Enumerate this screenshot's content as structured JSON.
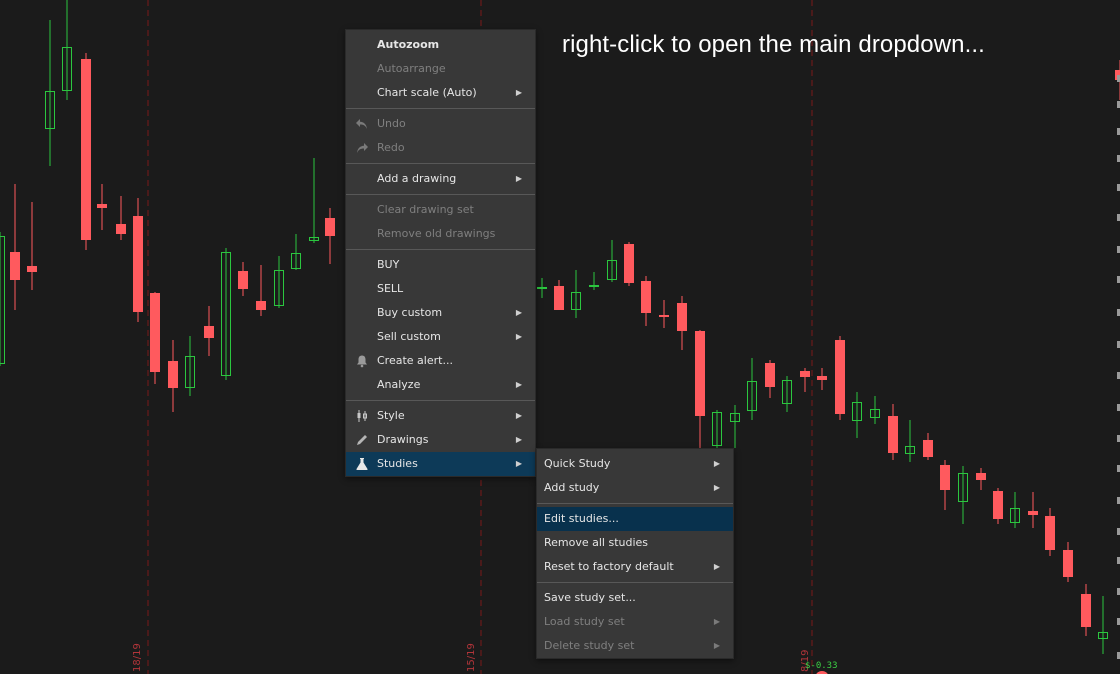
{
  "annotation": "right-click to open the main dropdown...",
  "chart": {
    "date_labels": [
      "18/19",
      "15/19",
      "8/19"
    ],
    "price_readout": "$-0.33",
    "colors": {
      "background": "#1b1b1b",
      "up": "#2bc63f",
      "down": "#ff5a5e",
      "session_line": "#7a1a1a",
      "readout": "#3ccf44"
    }
  },
  "main_menu": {
    "items": [
      {
        "label": "Autozoom",
        "bold": true
      },
      {
        "label": "Autoarrange",
        "disabled": true
      },
      {
        "label": "Chart scale (Auto)",
        "submenu": true
      },
      {
        "separator": true
      },
      {
        "label": "Undo",
        "disabled": true,
        "icon": "undo-icon"
      },
      {
        "label": "Redo",
        "disabled": true,
        "icon": "redo-icon"
      },
      {
        "separator": true
      },
      {
        "label": "Add a drawing",
        "submenu": true
      },
      {
        "separator": true
      },
      {
        "label": "Clear drawing set",
        "disabled": true
      },
      {
        "label": "Remove old drawings",
        "disabled": true
      },
      {
        "separator": true
      },
      {
        "label": "BUY"
      },
      {
        "label": "SELL"
      },
      {
        "label": "Buy custom",
        "submenu": true
      },
      {
        "label": "Sell custom",
        "submenu": true
      },
      {
        "label": "Create alert...",
        "icon": "bell-icon"
      },
      {
        "label": "Analyze",
        "submenu": true
      },
      {
        "separator": true
      },
      {
        "label": "Style",
        "submenu": true,
        "icon": "candlestick-icon"
      },
      {
        "label": "Drawings",
        "submenu": true,
        "icon": "pencil-icon"
      },
      {
        "label": "Studies",
        "submenu": true,
        "icon": "flask-icon",
        "selected": true
      }
    ]
  },
  "studies_menu": {
    "items": [
      {
        "label": "Quick Study",
        "submenu": true
      },
      {
        "label": "Add study",
        "submenu": true
      },
      {
        "separator": true
      },
      {
        "label": "Edit studies...",
        "highlight": true
      },
      {
        "label": "Remove all studies"
      },
      {
        "label": "Reset to factory default",
        "submenu": true
      },
      {
        "separator": true
      },
      {
        "label": "Save study set..."
      },
      {
        "label": "Load study set",
        "submenu": true,
        "disabled": true
      },
      {
        "label": "Delete study set",
        "submenu": true,
        "disabled": true
      }
    ]
  }
}
